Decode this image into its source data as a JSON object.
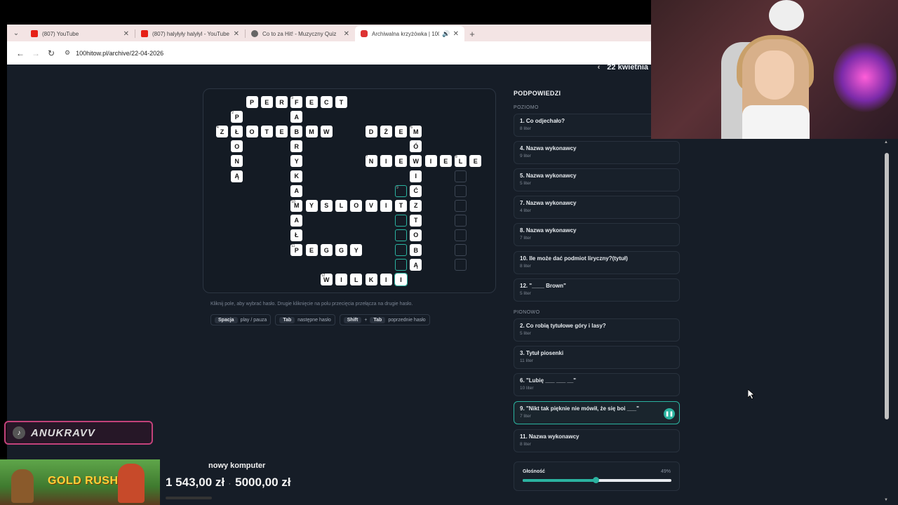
{
  "browser": {
    "tabs": [
      {
        "title": "(807) YouTube",
        "icon": "youtube-icon"
      },
      {
        "title": "(807) halyłyły halyłyl - YouTube",
        "icon": "youtube-icon"
      },
      {
        "title": "Co to za Hit! - Muzyczny Quiz",
        "icon": "globe-icon"
      },
      {
        "title": "Archiwalna krzyżówka | 100",
        "icon": "site-icon",
        "active": true
      }
    ],
    "url": "100hitow.pl/archive/22-04-2026"
  },
  "page": {
    "date": "22 kwietnia"
  },
  "crossword": {
    "cells": [
      {
        "r": 0,
        "c": 2,
        "t": "P"
      },
      {
        "r": 0,
        "c": 3,
        "t": "E"
      },
      {
        "r": 0,
        "c": 4,
        "t": "R"
      },
      {
        "r": 0,
        "c": 5,
        "t": "F",
        "n": "3"
      },
      {
        "r": 0,
        "c": 6,
        "t": "E"
      },
      {
        "r": 0,
        "c": 7,
        "t": "C"
      },
      {
        "r": 0,
        "c": 8,
        "t": "T"
      },
      {
        "r": 1,
        "c": 1,
        "t": "P",
        "n": "2"
      },
      {
        "r": 1,
        "c": 5,
        "t": "A"
      },
      {
        "r": 2,
        "c": 0,
        "t": "Z",
        "n": "4"
      },
      {
        "r": 2,
        "c": 1,
        "t": "Ł"
      },
      {
        "r": 2,
        "c": 2,
        "t": "O"
      },
      {
        "r": 2,
        "c": 3,
        "t": "T"
      },
      {
        "r": 2,
        "c": 4,
        "t": "E"
      },
      {
        "r": 2,
        "c": 5,
        "t": "B"
      },
      {
        "r": 2,
        "c": 6,
        "t": "M"
      },
      {
        "r": 2,
        "c": 7,
        "t": "W"
      },
      {
        "r": 2,
        "c": 10,
        "t": "D"
      },
      {
        "r": 2,
        "c": 11,
        "t": "Ż"
      },
      {
        "r": 2,
        "c": 12,
        "t": "E"
      },
      {
        "r": 2,
        "c": 13,
        "t": "M",
        "n": "6"
      },
      {
        "r": 3,
        "c": 1,
        "t": "O"
      },
      {
        "r": 3,
        "c": 5,
        "t": "R"
      },
      {
        "r": 3,
        "c": 13,
        "t": "Ó"
      },
      {
        "r": 4,
        "c": 1,
        "t": "N"
      },
      {
        "r": 4,
        "c": 5,
        "t": "Y"
      },
      {
        "r": 4,
        "c": 10,
        "t": "N",
        "n": "7"
      },
      {
        "r": 4,
        "c": 11,
        "t": "I"
      },
      {
        "r": 4,
        "c": 12,
        "t": "E"
      },
      {
        "r": 4,
        "c": 13,
        "t": "W"
      },
      {
        "r": 4,
        "c": 14,
        "t": "I"
      },
      {
        "r": 4,
        "c": 15,
        "t": "E"
      },
      {
        "r": 4,
        "c": 16,
        "t": "L",
        "n": "8"
      },
      {
        "r": 4,
        "c": 17,
        "t": "E"
      },
      {
        "r": 5,
        "c": 1,
        "t": "Ą"
      },
      {
        "r": 5,
        "c": 5,
        "t": "K"
      },
      {
        "r": 5,
        "c": 13,
        "t": "I"
      },
      {
        "r": 5,
        "c": 16,
        "t": "",
        "e": true
      },
      {
        "r": 6,
        "c": 5,
        "t": "A"
      },
      {
        "r": 6,
        "c": 12,
        "t": "",
        "h": true,
        "n": "9"
      },
      {
        "r": 6,
        "c": 13,
        "t": "Ć"
      },
      {
        "r": 6,
        "c": 16,
        "t": "",
        "e": true
      },
      {
        "r": 7,
        "c": 5,
        "t": "M",
        "n": "10"
      },
      {
        "r": 7,
        "c": 6,
        "t": "Y"
      },
      {
        "r": 7,
        "c": 7,
        "t": "S"
      },
      {
        "r": 7,
        "c": 8,
        "t": "L"
      },
      {
        "r": 7,
        "c": 9,
        "t": "O"
      },
      {
        "r": 7,
        "c": 10,
        "t": "V"
      },
      {
        "r": 7,
        "c": 11,
        "t": "I"
      },
      {
        "r": 7,
        "c": 12,
        "t": "T"
      },
      {
        "r": 7,
        "c": 13,
        "t": "Z"
      },
      {
        "r": 7,
        "c": 16,
        "t": "",
        "e": true
      },
      {
        "r": 8,
        "c": 5,
        "t": "A"
      },
      {
        "r": 8,
        "c": 12,
        "t": "",
        "h": true
      },
      {
        "r": 8,
        "c": 13,
        "t": "T"
      },
      {
        "r": 8,
        "c": 16,
        "t": "",
        "e": true
      },
      {
        "r": 9,
        "c": 5,
        "t": "Ł"
      },
      {
        "r": 9,
        "c": 12,
        "t": "",
        "h": true
      },
      {
        "r": 9,
        "c": 13,
        "t": "O"
      },
      {
        "r": 9,
        "c": 16,
        "t": "",
        "e": true
      },
      {
        "r": 10,
        "c": 5,
        "t": "P",
        "n": "11"
      },
      {
        "r": 10,
        "c": 6,
        "t": "E"
      },
      {
        "r": 10,
        "c": 7,
        "t": "G"
      },
      {
        "r": 10,
        "c": 8,
        "t": "G"
      },
      {
        "r": 10,
        "c": 9,
        "t": "Y"
      },
      {
        "r": 10,
        "c": 12,
        "t": "",
        "h": true
      },
      {
        "r": 10,
        "c": 13,
        "t": "B"
      },
      {
        "r": 10,
        "c": 16,
        "t": "",
        "e": true
      },
      {
        "r": 11,
        "c": 12,
        "t": "",
        "h": true
      },
      {
        "r": 11,
        "c": 13,
        "t": "Ą"
      },
      {
        "r": 11,
        "c": 16,
        "t": "",
        "e": true
      },
      {
        "r": 12,
        "c": 7,
        "t": "W",
        "n": "12"
      },
      {
        "r": 12,
        "c": 8,
        "t": "I"
      },
      {
        "r": 12,
        "c": 9,
        "t": "L"
      },
      {
        "r": 12,
        "c": 10,
        "t": "K"
      },
      {
        "r": 12,
        "c": 11,
        "t": "I"
      },
      {
        "r": 12,
        "c": 12,
        "t": "I",
        "hf": true
      }
    ],
    "hint": "Kliknij pole, aby wybrać hasło. Drugie kliknięcie na polu przecięcia przełącza na drugie hasło.",
    "keys": [
      {
        "keys": [
          "Spacja"
        ],
        "label": "play / pauza"
      },
      {
        "keys": [
          "Tab"
        ],
        "label": "następne hasło"
      },
      {
        "keys": [
          "Shift",
          "Tab"
        ],
        "plus": "+",
        "label": "poprzednie hasło"
      }
    ]
  },
  "clues": {
    "title": "PODPOWIEDZI",
    "across_label": "POZIOMO",
    "down_label": "PIONOWO",
    "across": [
      {
        "text": "1. Co odjechało?",
        "len": "8 liter"
      },
      {
        "text": "4. Nazwa wykonawcy",
        "len": "9 liter"
      },
      {
        "text": "5. Nazwa wykonawcy",
        "len": "5 liter"
      },
      {
        "text": "7. Nazwa wykonawcy",
        "len": "4 liter"
      },
      {
        "text": "8. Nazwa wykonawcy",
        "len": "7 liter"
      },
      {
        "text": "10. Ile może dać podmiot liryczny?(tytuł)",
        "len": "8 liter"
      },
      {
        "text": "12. \"____ Brown\"",
        "len": "5 liter"
      }
    ],
    "down": [
      {
        "text": "2. Co robią tytułowe góry i lasy?",
        "len": "5 liter"
      },
      {
        "text": "3. Tytuł piosenki",
        "len": "11 liter"
      },
      {
        "text": "6. \"Lubię ___ ___ __\"",
        "len": "10 liter"
      },
      {
        "text": "9. \"Nikt tak pięknie nie mówił, że się boi ___\"",
        "len": "7 liter",
        "active": true
      },
      {
        "text": "11. Nazwa wykonawcy",
        "len": "8 liter"
      }
    ],
    "volume": {
      "label": "Głośność",
      "percent_text": "49%",
      "value": 0.49
    }
  },
  "overlay": {
    "streamer": "ANUKRAVV",
    "game": "GOLD RUSH",
    "goal_label": "nowy komputer",
    "goal_current": "1 543,00 zł",
    "goal_target": "5000,00 zł",
    "accent": "#2bb3a0"
  }
}
